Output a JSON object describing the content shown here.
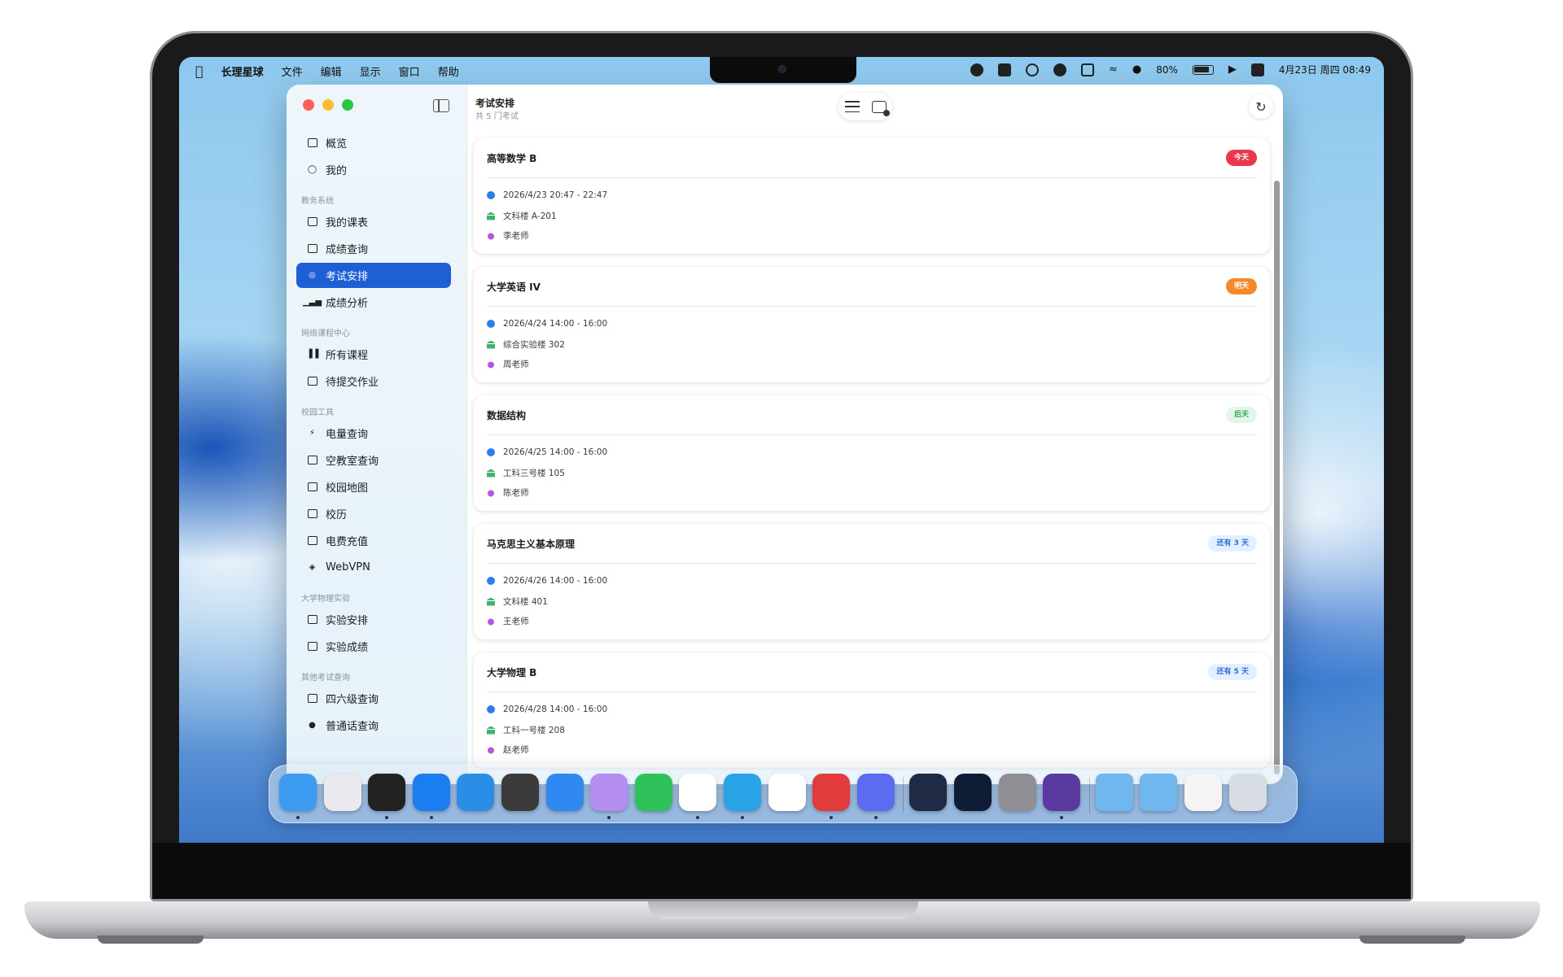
{
  "menubar": {
    "app_name": "长理星球",
    "menus": [
      "文件",
      "编辑",
      "显示",
      "窗口",
      "帮助"
    ],
    "battery": "80%",
    "datetime": "4月23日 周四 08:49"
  },
  "window": {
    "title": "考试安排",
    "subtitle": "共 5 门考试"
  },
  "sidebar": {
    "top_items": [
      {
        "label": "概览",
        "icon": "box-icon"
      },
      {
        "label": "我的",
        "icon": "person-icon"
      }
    ],
    "sections": [
      {
        "title": "教务系统",
        "items": [
          {
            "label": "我的课表",
            "icon": "calendar-icon"
          },
          {
            "label": "成绩查询",
            "icon": "document-search-icon"
          },
          {
            "label": "考试安排",
            "icon": "checkmark-seal-icon",
            "active": true
          },
          {
            "label": "成绩分析",
            "icon": "bar-chart-icon"
          }
        ]
      },
      {
        "title": "网络课程中心",
        "items": [
          {
            "label": "所有课程",
            "icon": "books-icon"
          },
          {
            "label": "待提交作业",
            "icon": "clipboard-icon"
          }
        ]
      },
      {
        "title": "校园工具",
        "items": [
          {
            "label": "电量查询",
            "icon": "bolt-icon"
          },
          {
            "label": "空教室查询",
            "icon": "building-icon"
          },
          {
            "label": "校园地图",
            "icon": "map-icon"
          },
          {
            "label": "校历",
            "icon": "calendar-clock-icon"
          },
          {
            "label": "电费充值",
            "icon": "credit-card-icon"
          },
          {
            "label": "WebVPN",
            "icon": "shield-icon"
          }
        ]
      },
      {
        "title": "大学物理实验",
        "items": [
          {
            "label": "实验安排",
            "icon": "calendar-icon"
          },
          {
            "label": "实验成绩",
            "icon": "document-icon"
          }
        ]
      },
      {
        "title": "其他考试查询",
        "items": [
          {
            "label": "四六级查询",
            "icon": "document-text-icon"
          },
          {
            "label": "普通话查询",
            "icon": "exclamation-circle-icon"
          }
        ]
      }
    ]
  },
  "exams": [
    {
      "name": "高等数学 B",
      "badge": "今天",
      "badge_color": "#e8384a",
      "time": "2026/4/23 20:47 - 22:47",
      "location": "文科楼 A-201",
      "teacher": "李老师"
    },
    {
      "name": "大学英语 IV",
      "badge": "明天",
      "badge_color": "#f28a2a",
      "time": "2026/4/24 14:00 - 16:00",
      "location": "综合实验楼 302",
      "teacher": "周老师"
    },
    {
      "name": "数据结构",
      "badge": "后天",
      "badge_color": "#2ea84a",
      "time": "2026/4/25 14:00 - 16:00",
      "location": "工科三号楼 105",
      "teacher": "陈老师"
    },
    {
      "name": "马克思主义基本原理",
      "badge": "还有 3 天",
      "badge_color": "#2f6ed8",
      "time": "2026/4/26 14:00 - 16:00",
      "location": "文科楼 401",
      "teacher": "王老师"
    },
    {
      "name": "大学物理 B",
      "badge": "还有 5 天",
      "badge_color": "#2f6ed8",
      "time": "2026/4/28 14:00 - 16:00",
      "location": "工科一号楼 208",
      "teacher": "赵老师"
    }
  ],
  "dock": {
    "apps": [
      {
        "name": "finder-icon",
        "color": "#3d9cf2",
        "running": true
      },
      {
        "name": "launchpad-icon",
        "color": "#e9e9ee",
        "running": false
      },
      {
        "name": "activity-monitor-icon",
        "color": "#222222",
        "running": true
      },
      {
        "name": "xcode-icon",
        "color": "#1a7df0",
        "running": true
      },
      {
        "name": "vscode-icon",
        "color": "#2a8ee6",
        "running": false
      },
      {
        "name": "terminal-app-icon",
        "color": "#3b3b3b",
        "running": false
      },
      {
        "name": "fork-icon",
        "color": "#2f89f0",
        "running": false
      },
      {
        "name": "cat-app-icon",
        "color": "#b48ef0",
        "running": true
      },
      {
        "name": "wechat-icon",
        "color": "#2fc25b",
        "running": false
      },
      {
        "name": "qq-icon",
        "color": "#ffffff",
        "running": true
      },
      {
        "name": "telegram-icon",
        "color": "#2aa3e6",
        "running": true
      },
      {
        "name": "mail-check-icon",
        "color": "#ffffff",
        "running": false
      },
      {
        "name": "netease-music-icon",
        "color": "#e23b3b",
        "running": true
      },
      {
        "name": "chat-app-icon",
        "color": "#5b6cf0",
        "running": true
      },
      {
        "name": "kotlin-app-icon",
        "color": "#1f2a44",
        "running": false
      },
      {
        "name": "player-icon",
        "color": "#0f1c36",
        "running": false
      },
      {
        "name": "system-settings-icon",
        "color": "#8e8e93",
        "running": false
      },
      {
        "name": "camera-app-icon",
        "color": "#5a3aa0",
        "running": true
      },
      {
        "name": "downloads-folder-icon",
        "color": "#6fb7ee",
        "running": false
      },
      {
        "name": "folder-icon",
        "color": "#6fb7ee",
        "running": false
      },
      {
        "name": "screenshot-stack-icon",
        "color": "#f4f4f4",
        "running": false
      },
      {
        "name": "trash-icon",
        "color": "#d8dde3",
        "running": false
      }
    ]
  }
}
